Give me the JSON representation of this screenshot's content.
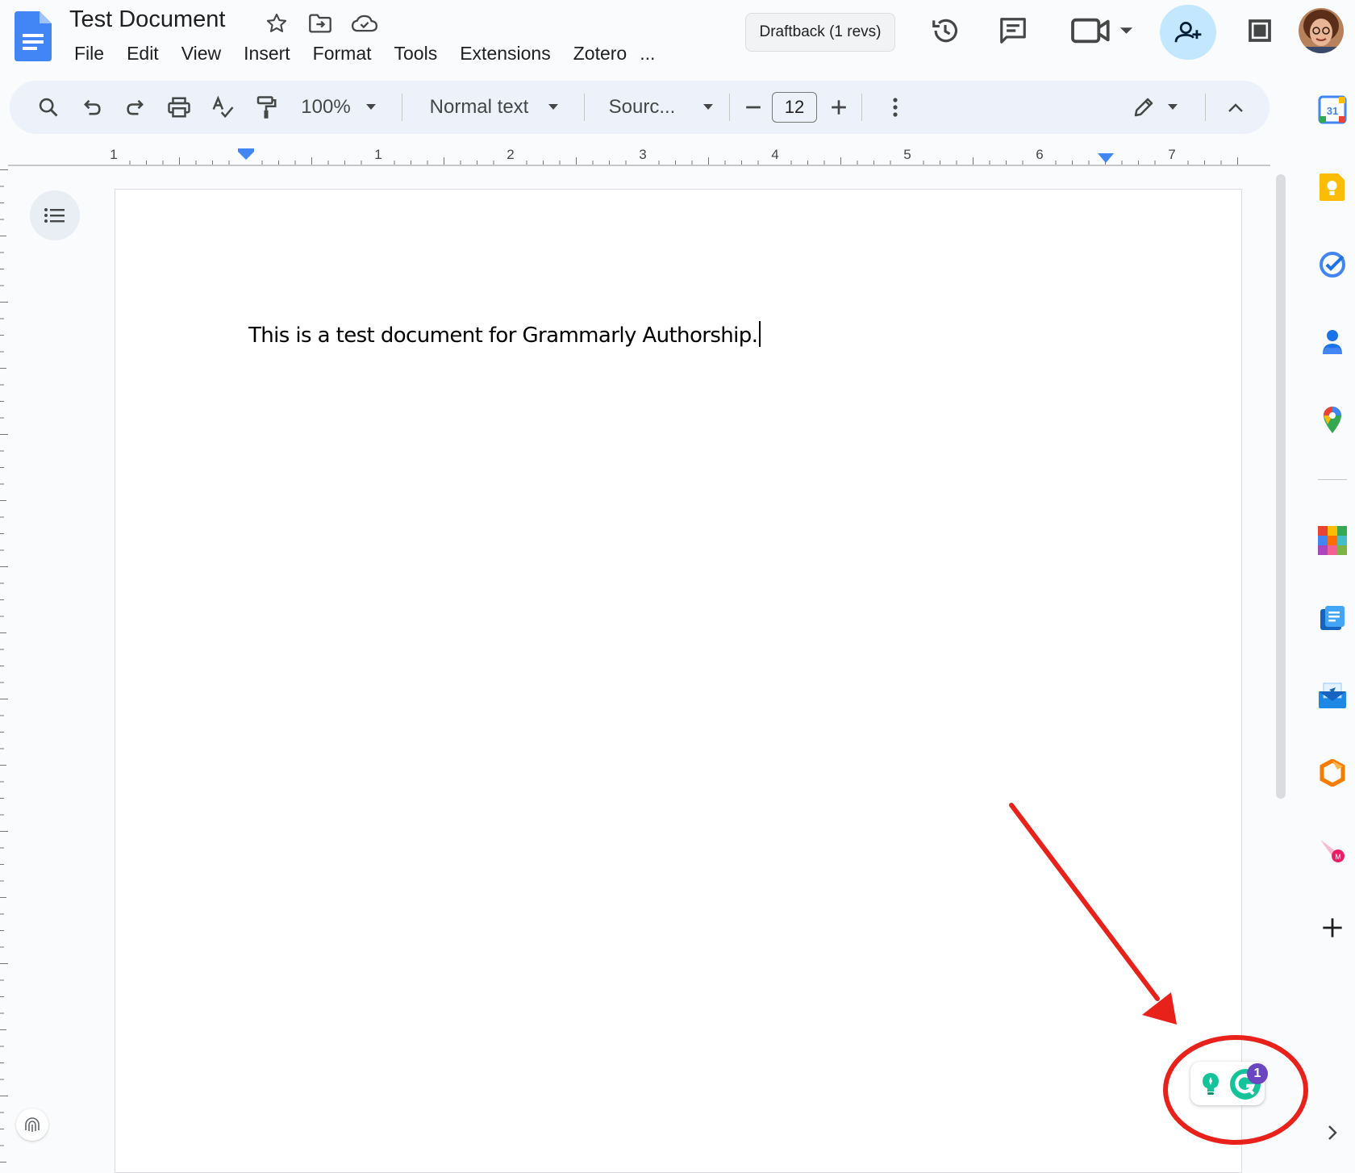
{
  "header": {
    "title": "Test Document",
    "menu": [
      "File",
      "Edit",
      "View",
      "Insert",
      "Format",
      "Tools",
      "Extensions",
      "Zotero",
      "..."
    ],
    "draftback_label": "Draftback (1 revs)"
  },
  "toolbar": {
    "zoom": "100%",
    "style": "Normal text",
    "font": "Sourc...",
    "font_size": "12"
  },
  "ruler": {
    "labels": [
      "1",
      "1",
      "2",
      "3",
      "4",
      "5",
      "6",
      "7"
    ]
  },
  "document": {
    "text": "This is a test document for Grammarly Authorship."
  },
  "grammarly": {
    "badge_count": "1"
  },
  "side_panel": {
    "calendar_day": "31"
  },
  "colors": {
    "accent": "#0b57d0",
    "share_bg": "#c2e7ff",
    "toolbar_bg": "#edf2fa",
    "annotation_red": "#e8211b",
    "grammarly_green": "#15c39a"
  }
}
